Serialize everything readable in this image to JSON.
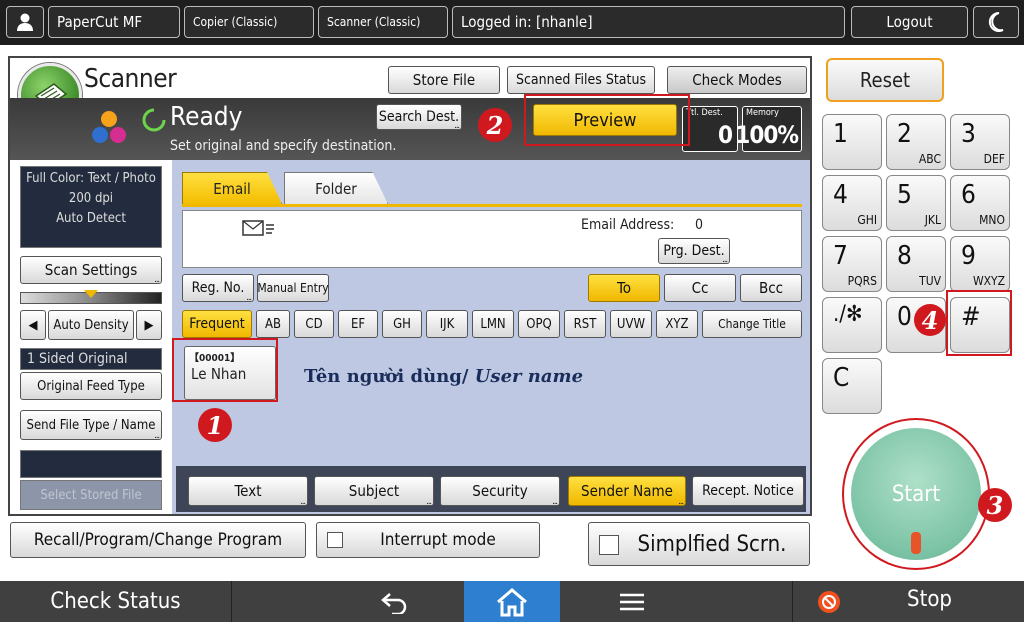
{
  "topbar": {
    "app": "PaperCut MF",
    "copier": "Copier (Classic)",
    "scanner": "Scanner (Classic)",
    "logged_in": "Logged in: [nhanle]",
    "logout": "Logout"
  },
  "header": {
    "title": "Scanner",
    "store_file": "Store File",
    "scanned_files_status": "Scanned Files Status",
    "check_modes": "Check Modes",
    "ready": "Ready",
    "instruction": "Set original and specify destination.",
    "search_dest": "Search Dest.",
    "preview": "Preview",
    "ttl_dest_label": "Ttl. Dest.",
    "ttl_dest_value": "0",
    "memory_label": "Memory",
    "memory_value": "100%"
  },
  "left": {
    "mode_line1": "Full Color: Text / Photo",
    "mode_line2": "200 dpi",
    "mode_line3": "Auto Detect",
    "scan_settings": "Scan Settings",
    "auto_density": "Auto Density",
    "sided": "1 Sided Original",
    "feed_type": "Original Feed Type",
    "send_file_type": "Send File Type / Name",
    "select_stored_file": "Select Stored File"
  },
  "work": {
    "tab_email": "Email",
    "tab_folder": "Folder",
    "email_address_label": "Email Address:",
    "email_address_count": "0",
    "prg_dest": "Prg. Dest.",
    "reg_no": "Reg. No.",
    "manual_entry": "Manual Entry",
    "to": "To",
    "cc": "Cc",
    "bcc": "Bcc",
    "letters": [
      "Frequent",
      "AB",
      "CD",
      "EF",
      "GH",
      "IJK",
      "LMN",
      "OPQ",
      "RST",
      "UVW",
      "XYZ",
      "Change Title"
    ],
    "entry_code": "【00001】",
    "entry_name": "Le Nhan",
    "user_caption_vn": "Tên người dùng/",
    "user_caption_en": "User name",
    "bottom_tabs": [
      "Text",
      "Subject",
      "Security",
      "Sender Name",
      "Recept. Notice"
    ]
  },
  "below": {
    "recall": "Recall/Program/Change Program",
    "interrupt": "Interrupt mode",
    "simplified": "Simplfied Scrn."
  },
  "keypad": {
    "reset": "Reset",
    "keys": [
      {
        "num": "1",
        "sub": ""
      },
      {
        "num": "2",
        "sub": "ABC"
      },
      {
        "num": "3",
        "sub": "DEF"
      },
      {
        "num": "4",
        "sub": "GHI"
      },
      {
        "num": "5",
        "sub": "JKL"
      },
      {
        "num": "6",
        "sub": "MNO"
      },
      {
        "num": "7",
        "sub": "PQRS"
      },
      {
        "num": "8",
        "sub": "TUV"
      },
      {
        "num": "9",
        "sub": "WXYZ"
      },
      {
        "num": "./✻",
        "sub": ""
      },
      {
        "num": "0",
        "sub": ""
      },
      {
        "num": "#",
        "sub": ""
      }
    ],
    "clear": "C",
    "start": "Start"
  },
  "markers": [
    "1",
    "2",
    "3",
    "4"
  ],
  "bottombar": {
    "check_status": "Check Status",
    "stop": "Stop"
  }
}
